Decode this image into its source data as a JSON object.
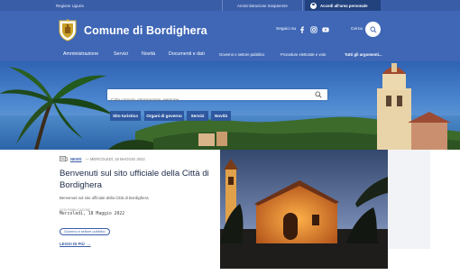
{
  "utility": {
    "region": "Regione Liguria",
    "transparency": "Amministrazione trasparente",
    "login": "Accedi all'area personale"
  },
  "header": {
    "site_title": "Comune di Bordighera",
    "follow_label": "Seguici su",
    "social_icons": [
      "facebook-icon",
      "instagram-icon",
      "youtube-icon"
    ],
    "search_label": "Cerca"
  },
  "nav": {
    "items": [
      "Amministrazione",
      "Servizi",
      "Novità",
      "Documenti e dati"
    ],
    "extra_items": [
      "Governo e settore pubblico",
      "Procedure elettorale e voto"
    ],
    "all_topics": "Tutti gli argomenti..."
  },
  "hero": {
    "search_placeholder": "Città comodi, informazioni, persone",
    "chips": [
      "Sito turistico",
      "Organi di governo",
      "Servizi",
      "Novità"
    ]
  },
  "news": {
    "category_tag": "NEWS",
    "date_meta": "— MERCOLEDÌ, 18 MAGGIO 2022",
    "headline": "Benvenuti sul sito ufficiale della Città di Bordighera",
    "subtext": "Benvenuti sul sito ufficiale della Città di Bordighera",
    "date_label": "DATA PUBBLICAZIONE",
    "date_value": "Mercoledì, 18 Maggio 2022",
    "badge": "Governo e settore pubblico",
    "read_more": "LEGGI DI PIÙ"
  },
  "colors": {
    "header_blue": "#3f67b6",
    "utility_blue": "#3a5da8",
    "login_blue": "#22427e",
    "chip_blue": "#2d579f"
  }
}
